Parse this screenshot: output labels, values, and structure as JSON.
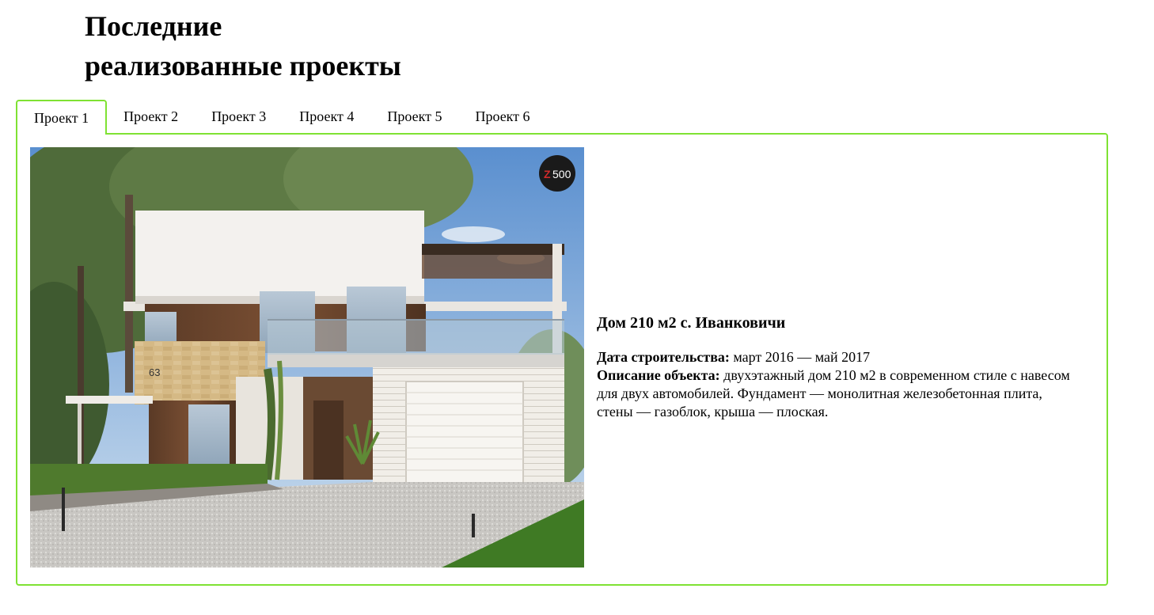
{
  "heading": {
    "line1": "Последние",
    "line2": "реализованные проекты"
  },
  "tabs": [
    {
      "label": "Проект 1",
      "active": true
    },
    {
      "label": "Проект 2",
      "active": false
    },
    {
      "label": "Проект 3",
      "active": false
    },
    {
      "label": "Проект 4",
      "active": false
    },
    {
      "label": "Проект 5",
      "active": false
    },
    {
      "label": "Проект 6",
      "active": false
    }
  ],
  "project": {
    "title": "Дом 210 м2 с. Иванковичи",
    "date_label": "Дата строительства:",
    "date_value": "март 2016 — май 2017",
    "desc_label": "Описание объекта:",
    "desc_value": "двухэтажный дом 210 м2 в современном стиле с навесом для двух автомобилей. Фундамент — монолитная железобетонная плита, стены — газоблок, крыша — плоская."
  },
  "photo": {
    "logo_letter": "Z",
    "logo_number": "500",
    "house_number": "63"
  },
  "colors": {
    "accent": "#7fe233",
    "text": "#000000"
  }
}
